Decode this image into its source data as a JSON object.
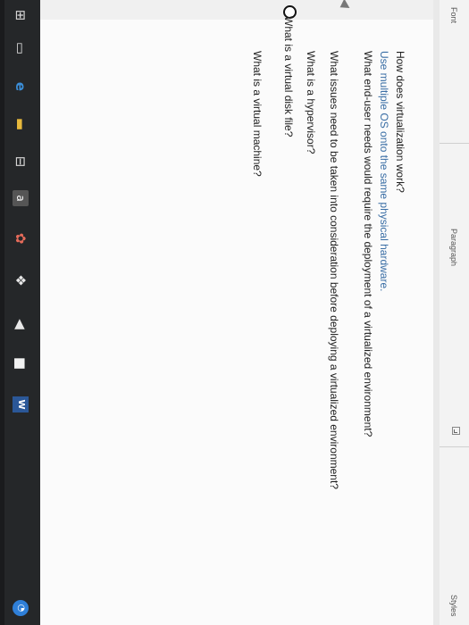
{
  "ribbon": {
    "font_label": "Font",
    "paragraph_label": "Paragraph",
    "styles_label": "Styles"
  },
  "document": {
    "lines": [
      "How does virtualization work?",
      "Use multiple OS onto the same physical hardware.",
      "What end-user needs would require the deployment of a virtualized environment?",
      "What issues need to be taken into consideration before deploying a virtualized environment?",
      "What is a hypervisor?",
      "What is a virtual disk file?",
      "What is a virtual machine?"
    ]
  },
  "taskbar": {
    "icons": [
      "start-icon",
      "task-view-icon",
      "edge-browser-icon",
      "file-explorer-icon",
      "store-icon",
      "amazon-icon",
      "paint-icon",
      "dropbox-icon",
      "mail-icon",
      "notes-icon",
      "word-icon",
      "notification-icon"
    ],
    "amazon_glyph": "a",
    "word_glyph": "W",
    "active_app": "word",
    "accent_color": "#8fb4e6"
  },
  "colors": {
    "answer_text": "#3a6ea5",
    "body_text": "#1f1f1f",
    "taskbar": "#252729"
  }
}
